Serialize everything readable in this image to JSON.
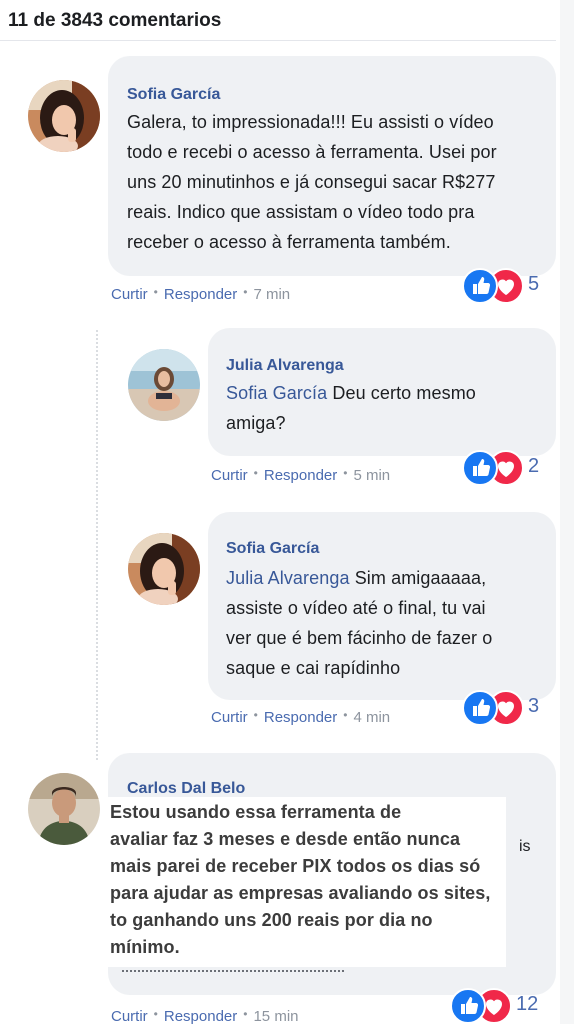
{
  "header": {
    "title": "11 de 3843 comentarios"
  },
  "comments": [
    {
      "author": "Sofia García",
      "text": "Galera, to impressionada!!! Eu assisti o vídeo todo e recebi o acesso à ferramenta. Usei por uns 20 minutinhos e já consegui sacar R$277 reais. Indico que assistam o vídeo todo pra receber o acesso à ferramenta também.",
      "lines": [
        "Galera, to impressionada!!! Eu assisti o vídeo",
        "todo e recebi o acesso à ferramenta. Usei por",
        "uns 20 minutinhos e já consegui sacar R$277",
        "reais. Indico que assistam o vídeo todo pra",
        "receber o acesso à ferramenta também."
      ],
      "like_label": "Curtir",
      "reply_label": "Responder",
      "time": "7 min",
      "reaction_count": "5"
    },
    {
      "author": "Julia Alvarenga",
      "mention": "Sofia García",
      "lines": [
        "Deu certo mesmo",
        "amiga?"
      ],
      "like_label": "Curtir",
      "reply_label": "Responder",
      "time": "5 min",
      "reaction_count": "2"
    },
    {
      "author": "Sofia García",
      "mention": "Julia Alvarenga",
      "lines": [
        "Sim amigaaaaa,",
        "assiste o vídeo até o final, tu vai",
        "ver que é bem fácinho de fazer o",
        "saque e cai rapídinho"
      ],
      "like_label": "Curtir",
      "reply_label": "Responder",
      "time": "4 min",
      "reaction_count": "3"
    },
    {
      "author": "Carlos Dal Belo",
      "lines": [
        "Estou usando essa ferramenta de",
        "avaliar faz 3 meses e desde então nunca",
        "mais parei de receber PIX todos os dias só",
        "para ajudar as empresas avaliando os sites,",
        "to ganhando uns 200 reais por dia no",
        "mínimo."
      ],
      "stray_text": "is",
      "like_label": "Curtir",
      "reply_label": "Responder",
      "time": "15 min",
      "reaction_count": "12"
    }
  ],
  "icons": {
    "like": "thumbs-up-icon",
    "love": "heart-icon"
  },
  "colors": {
    "link": "#385898",
    "like": "#1877f2",
    "love": "#f02849",
    "bubble": "#eff1f4"
  }
}
